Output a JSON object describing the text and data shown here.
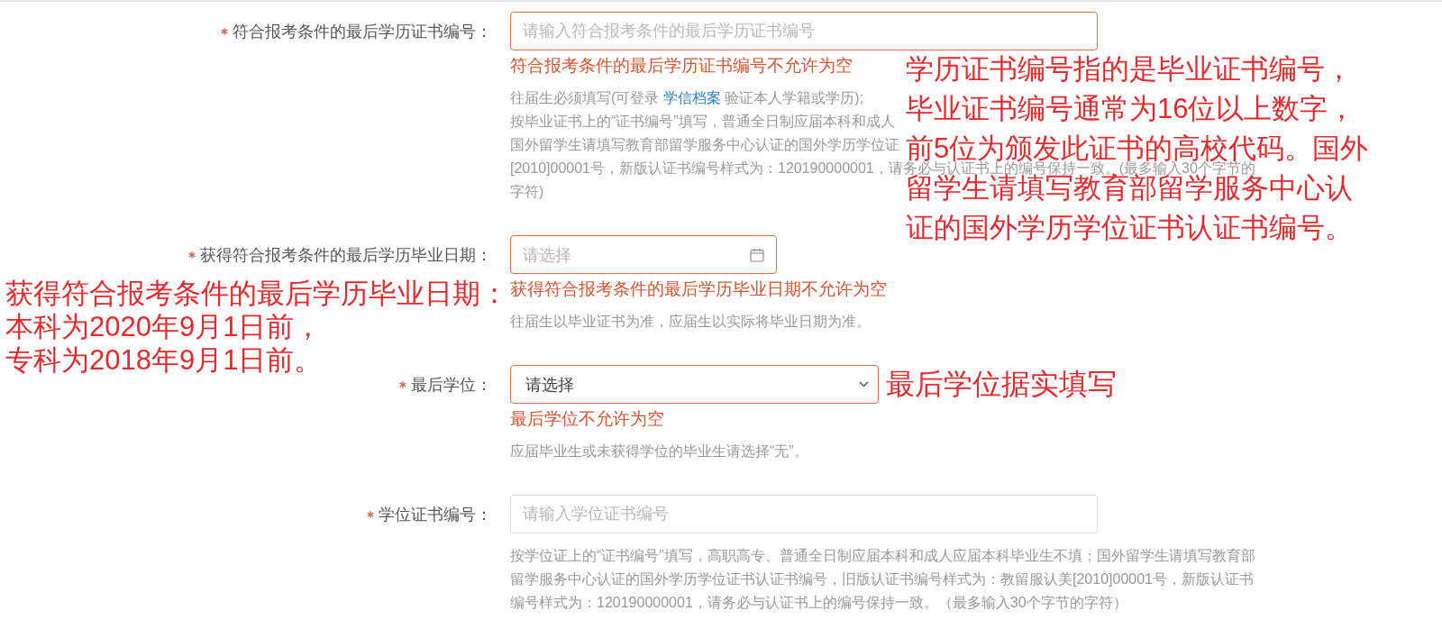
{
  "form": {
    "items": [
      {
        "kind": "text",
        "required": true,
        "label": "符合报考条件的最后学历证书编号：",
        "placeholder": "请输入符合报考条件的最后学历证书编号",
        "error": "符合报考条件的最后学历证书编号不允许为空",
        "help": [
          {
            "text": "往届生必须填写(可登录 ",
            "link": "学信档案",
            "text_after": " 验证本人学籍或学历);"
          },
          {
            "text": "按毕业证书上的“证书编号”填写，普通全日制应届本科和成人"
          },
          {
            "text": "国外留学生请填写教育部留学服务中心认证的国外学历学位证"
          },
          {
            "text": "[2010]00001号，新版认证书编号样式为：120190000001，请务必与认证书上的编号保持一致。(最多输入30个字节的"
          },
          {
            "text": "字符)"
          }
        ],
        "annotation": {
          "kind": "overlay",
          "lines": [
            "学历证书编号指的是毕业证书编号，",
            "毕业证书编号通常为16位以上数字，",
            "前5位为颁发此证书的高校代码。国外",
            "留学生请填写教育部留学服务中心认",
            "证的国外学历学位证书认证书编号。"
          ]
        }
      },
      {
        "kind": "date",
        "required": true,
        "label": "获得符合报考条件的最后学历毕业日期：",
        "placeholder": "请选择",
        "error": "获得符合报考条件的最后学历毕业日期不允许为空",
        "help": [
          {
            "text": "往届生以毕业证书为准，应届生以实际将毕业日期为准。"
          }
        ],
        "annotation": {
          "kind": "margin",
          "lines": [
            "获得符合报考条件的最后学历毕业日期：",
            "本科为2020年9月1日前，",
            "专科为2018年9月1日前。"
          ]
        }
      },
      {
        "kind": "select",
        "required": true,
        "label": "最后学位：",
        "value": "请选择",
        "error": "最后学位不允许为空",
        "help": [
          {
            "text": "应届毕业生或未获得学位的毕业生请选择“无”。"
          }
        ],
        "annotation": {
          "kind": "inline",
          "lines": [
            "最后学位据实填写"
          ]
        }
      },
      {
        "kind": "text",
        "required": true,
        "label": "学位证书编号：",
        "placeholder": "请输入学位证书编号",
        "help": [
          {
            "text": "按学位证上的“证书编号”填写，高职高专、普通全日制应届本科和成人应届本科毕业生不填；国外留学生请填写教育部留学服务中心认证的国外学历学位证书认证书编号，旧版认证书编号样式为：教留服认美[2010]00001号，新版认证书编号样式为：120190000001，请务必与认证书上的编号保持一致。（最多输入30个字节的字符）"
          }
        ]
      }
    ]
  }
}
